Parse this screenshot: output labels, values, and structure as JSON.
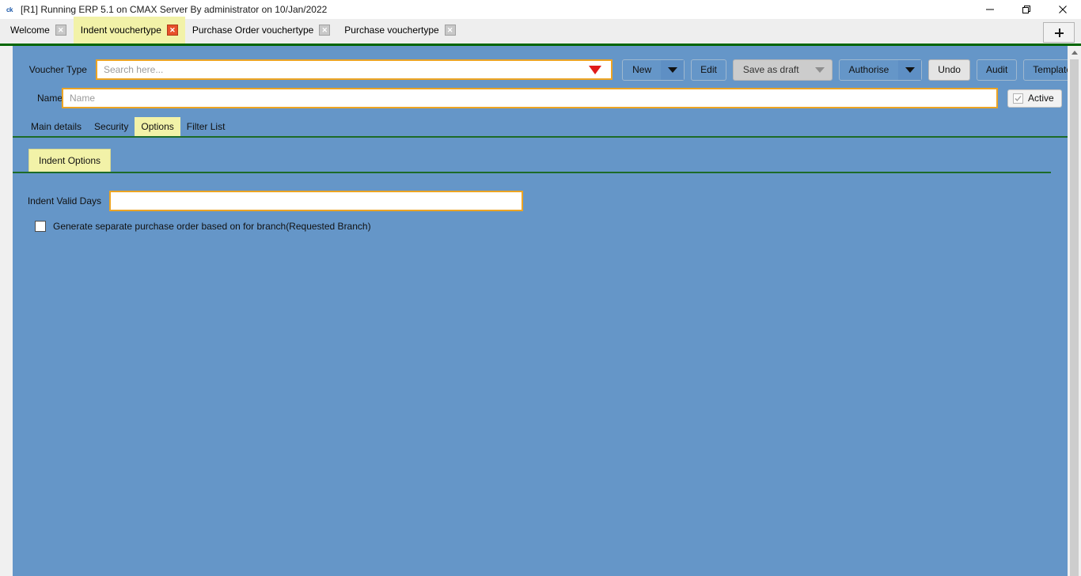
{
  "window": {
    "title": "[R1] Running ERP 5.1 on CMAX Server By administrator on 10/Jan/2022",
    "app_icon": "ck",
    "minimize_label": "minimize-icon",
    "restore_label": "restore-icon",
    "close_label": "close-icon"
  },
  "tabstrip": {
    "tabs": [
      {
        "label": "Welcome",
        "active": false,
        "close": "✕"
      },
      {
        "label": "Indent vouchertype",
        "active": true,
        "close": "✕"
      },
      {
        "label": "Purchase Order vouchertype",
        "active": false,
        "close": "✕"
      },
      {
        "label": "Purchase vouchertype",
        "active": false,
        "close": "✕"
      }
    ],
    "new_tab_label": "+"
  },
  "toolbar": {
    "voucher_type_label": "Voucher Type",
    "search_placeholder": "Search here...",
    "buttons": {
      "new_label": "New",
      "edit_label": "Edit",
      "save_as_draft_label": "Save as draft",
      "authorise_label": "Authorise",
      "undo_label": "Undo",
      "audit_label": "Audit",
      "template_label": "Template"
    }
  },
  "name_row": {
    "label": "Name",
    "placeholder": "Name",
    "value": "",
    "active_label": "Active",
    "active_checked": true
  },
  "tabs": {
    "items": [
      {
        "label": "Main details",
        "active": false
      },
      {
        "label": "Security",
        "active": false
      },
      {
        "label": "Options",
        "active": true
      },
      {
        "label": "Filter List",
        "active": false
      }
    ]
  },
  "section": {
    "tab_label": "Indent Options"
  },
  "form": {
    "indent_valid_days_label": "Indent Valid Days",
    "indent_valid_days_value": "",
    "generate_separate_po_label": "Generate separate purchase order based on for branch(Requested Branch)",
    "generate_separate_po_checked": false
  },
  "colors": {
    "background": "#6596c8",
    "field_border": "#eca424",
    "tab_active": "#f2f2a8",
    "divider_green": "#1d6b28",
    "close_active": "#e8502a"
  }
}
